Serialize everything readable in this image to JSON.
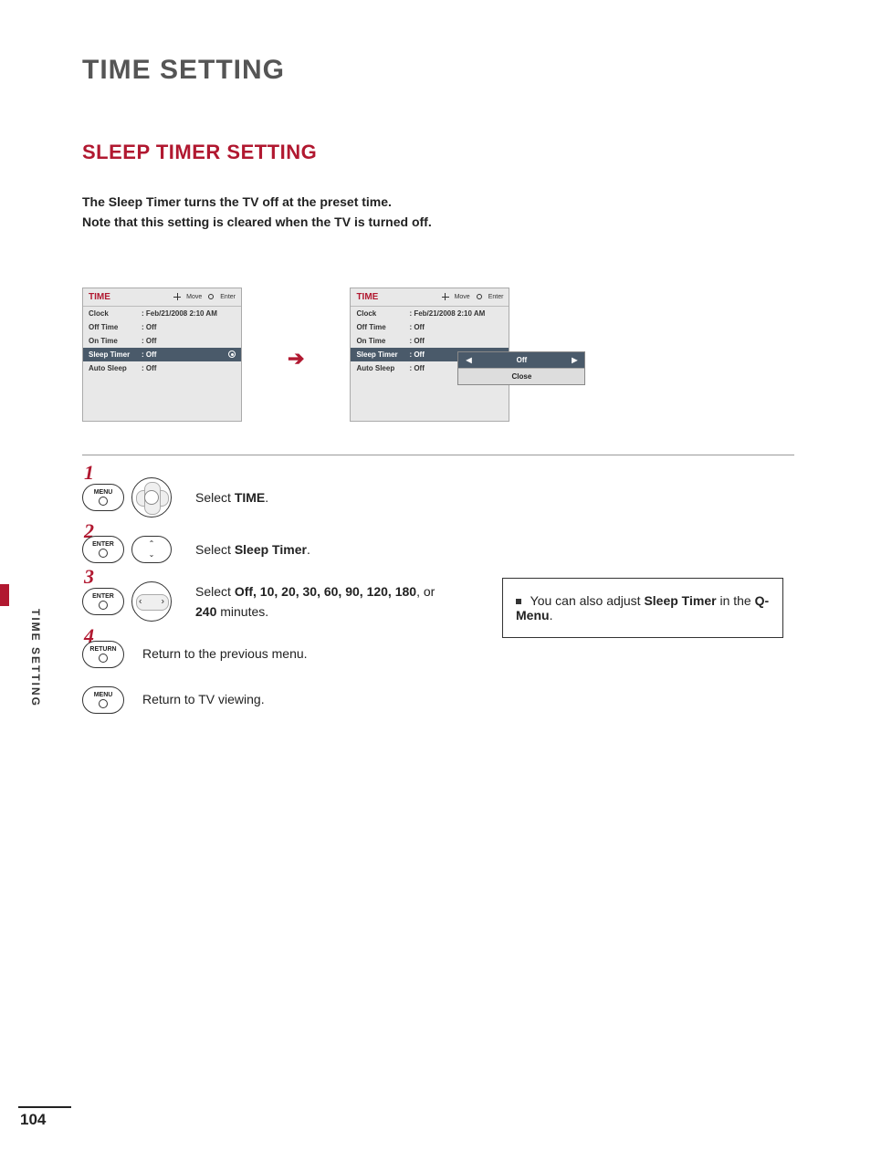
{
  "title": "TIME SETTING",
  "subtitle": "SLEEP TIMER SETTING",
  "intro_line1": "The Sleep Timer turns the TV off at the preset time.",
  "intro_line2": "Note that this setting is cleared when the TV is turned off.",
  "osd": {
    "header_title": "TIME",
    "hint_move": "Move",
    "hint_enter": "Enter",
    "rows": [
      {
        "label": "Clock",
        "value": ": Feb/21/2008  2:10 AM"
      },
      {
        "label": "Off Time",
        "value": ": Off"
      },
      {
        "label": "On Time",
        "value": ": Off"
      },
      {
        "label": "Sleep Timer",
        "value": ": Off"
      },
      {
        "label": "Auto Sleep",
        "value": ": Off"
      }
    ],
    "selected_index": 3
  },
  "dropdown": {
    "value": "Off",
    "close": "Close"
  },
  "arrow_glyph": "➔",
  "sidebar_label": "TIME SETTING",
  "steps": {
    "s1_btn": "MENU",
    "s1_text_pre": "Select ",
    "s1_text_b": "TIME",
    "s1_text_post": ".",
    "s2_btn": "ENTER",
    "s2_text_pre": "Select ",
    "s2_text_b": "Sleep Timer",
    "s2_text_post": ".",
    "s3_btn": "ENTER",
    "s3_text_pre": "Select ",
    "s3_text_b": "Off, 10, 20, 30, 60, 90, 120, 180",
    "s3_text_mid": ", or ",
    "s3_text_b2": "240",
    "s3_text_post": " minutes.",
    "s4_btn_return": "RETURN",
    "s4_text": "Return to the previous menu.",
    "s5_btn_menu": "MENU",
    "s5_text": "Return to TV viewing."
  },
  "note": {
    "pre": "You can also adjust ",
    "b1": "Sleep Timer",
    "mid": " in the ",
    "b2": "Q-Menu",
    "post": "."
  },
  "page_number": "104",
  "nums": {
    "n1": "1",
    "n2": "2",
    "n3": "3",
    "n4": "4"
  }
}
